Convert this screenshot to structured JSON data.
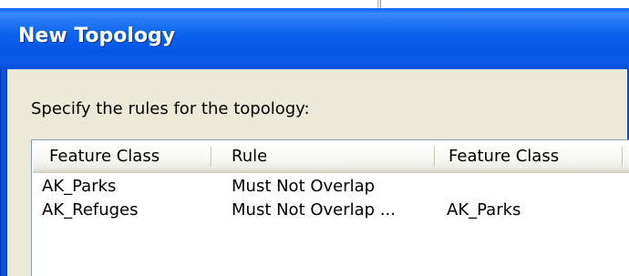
{
  "dialog": {
    "title": "New Topology",
    "prompt": "Specify the rules for the topology:"
  },
  "rules_list": {
    "columns": [
      "Feature Class",
      "Rule",
      "Feature Class"
    ],
    "rows": [
      {
        "feature_class": "AK_Parks",
        "rule": "Must Not Overlap",
        "feature_class_2": ""
      },
      {
        "feature_class": "AK_Refuges",
        "rule": "Must Not Overlap ...",
        "feature_class_2": "AK_Parks"
      }
    ]
  },
  "colors": {
    "titlebar": "#0858e8",
    "client_background": "#ece9d8",
    "list_border": "#7f9db9"
  }
}
